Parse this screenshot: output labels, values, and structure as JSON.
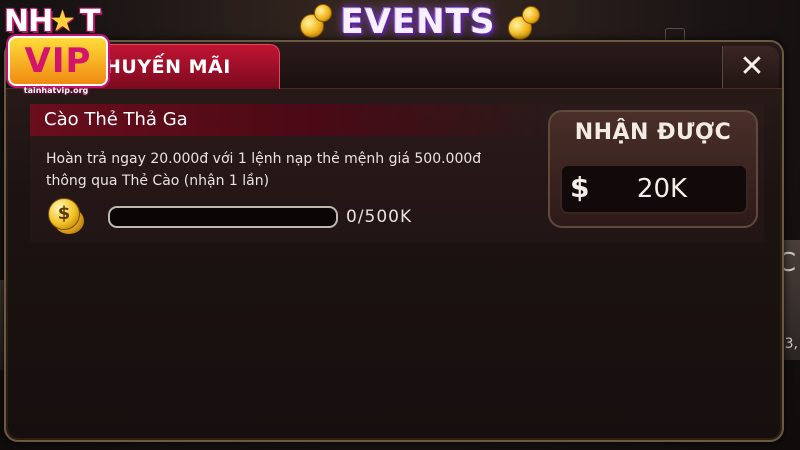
{
  "header": {
    "title": "EVENTS",
    "logo": {
      "top_text_left": "NH",
      "top_text_right": "T",
      "main_text": "VIP",
      "site": "tainhatvip.org"
    }
  },
  "tabs": [
    {
      "label": "KHUYẾN MÃI",
      "visible_label": "HUYẾN MÃI",
      "active": true
    }
  ],
  "close_icon": "close-icon",
  "event": {
    "title": "Cào Thẻ Thả Ga",
    "description_line1": "Hoàn trả ngay 20.000đ với 1 lệnh nạp thẻ mệnh giá 500.000đ",
    "description_line2": "thông qua Thẻ Cào (nhận 1 lần)",
    "progress_text": "0/500K",
    "progress_fraction": 0,
    "reward_label": "NHẬN ĐƯỢC",
    "reward_currency_icon": "$",
    "reward_value": "20K"
  },
  "background": {
    "right_text": "ỐC",
    "right_text2": "3,"
  },
  "colors": {
    "tab_active": "#c11433",
    "panel_border": "#6b5a42",
    "title_bar": "#6a0d1c",
    "events_glow": "#8a4fe0"
  }
}
